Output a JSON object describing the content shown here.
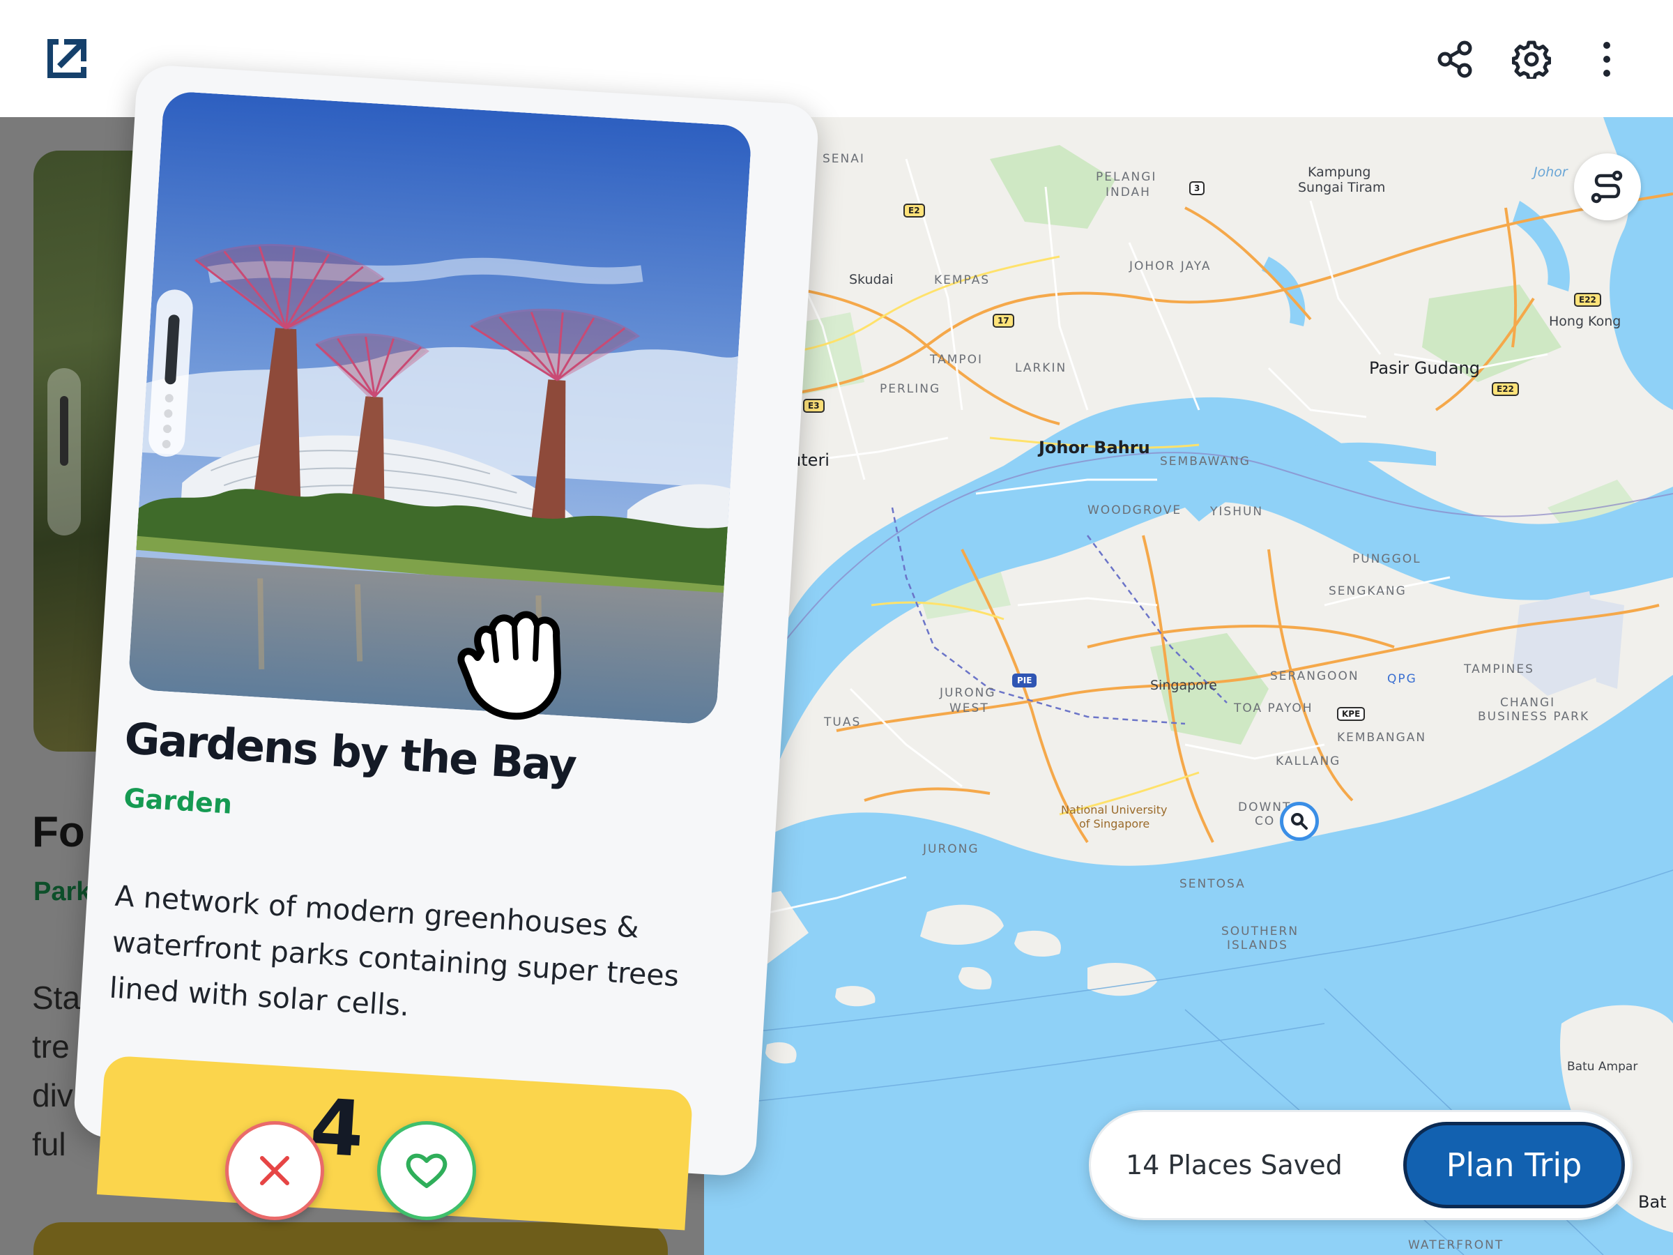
{
  "topbar": {
    "logo_icon": "open-external-icon",
    "share_icon": "share-icon",
    "settings_icon": "gear-icon",
    "more_icon": "more-vertical-icon"
  },
  "background_card": {
    "title": "Fo",
    "category": "Park",
    "description_lines": [
      "Sta",
      "tre",
      "div",
      "ful"
    ]
  },
  "card": {
    "title": "Gardens by the Bay",
    "category": "Garden",
    "description": "A network of modern greenhouses & waterfront parks containing super trees lined with solar cells.",
    "bottom_text": "4",
    "image_subject": "Supertree Grove at Gardens by the Bay"
  },
  "actions": {
    "reject_icon": "close-icon",
    "like_icon": "heart-icon",
    "cursor_icon": "grab-hand-icon"
  },
  "map": {
    "labels": {
      "senai": "SENAI",
      "pelangi": "PELANGI",
      "indah": "INDAH",
      "kampung": "Kampung",
      "sungai": "Sungai Tiram",
      "johor": "Johor",
      "skudai": "Skudai",
      "kempas": "KEMPAS",
      "johorjaya": "JOHOR JAYA",
      "hongkong": "Hong Kong",
      "tampoi": "TAMPOI",
      "larkin": "LARKIN",
      "pasir": "Pasir Gudang",
      "perling": "PERLING",
      "puteri": "Puteri",
      "johorbahru": "Johor Bahru",
      "sembawang": "SEMBAWANG",
      "woodgrove": "WOODGROVE",
      "yishun": "YISHUN",
      "punggol": "PUNGGOL",
      "sengkang": "SENGKANG",
      "jurongwest1": "JURONG",
      "jurongwest2": "WEST",
      "singapore": "Singapore",
      "serangoon": "SERANGOON",
      "qpg": "QPG",
      "tampines": "TAMPINES",
      "changi1": "CHANGI",
      "changi2": "BUSINESS PARK",
      "tuas": "TUAS",
      "toapayoh": "TOA PAYOH",
      "kembangan": "KEMBANGAN",
      "kallang": "KALLANG",
      "nus1": "National University",
      "nus2": "of Singapore",
      "downtown": "DOWNT",
      "core": "CO",
      "jurong": "JURONG",
      "sentosa": "SENTOSA",
      "southern1": "SOUTHERN",
      "southern2": "ISLANDS",
      "batuampar": "Batu Ampar",
      "bat": "Bat",
      "waterfront": "WATERFRONT"
    },
    "shields": {
      "e2": "E2",
      "r3": "3",
      "r17": "17",
      "e3": "E3",
      "e22a": "E22",
      "e22b": "E22",
      "pie": "PIE",
      "kpe": "KPE"
    },
    "route_icon": "route-icon",
    "search_pin_icon": "search-icon"
  },
  "savebar": {
    "saved_label": "14 Places Saved",
    "plan_button": "Plan Trip"
  },
  "colors": {
    "accent_blue": "#1261b0",
    "garden_green": "#159a52",
    "card_yellow": "#fbd54c",
    "water": "#8fd1f7",
    "land": "#f1f0ec"
  }
}
